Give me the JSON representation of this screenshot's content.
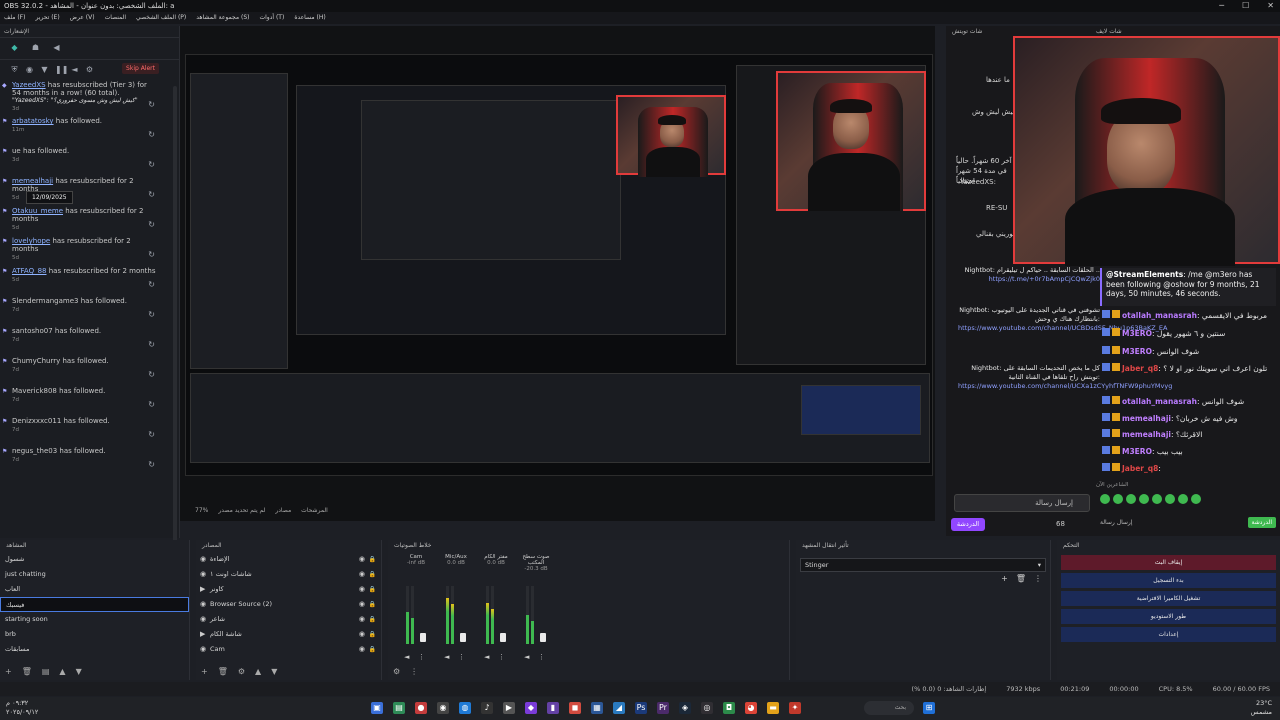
{
  "window": {
    "title": "OBS 32.0.2 - الملف الشخصي: بدون عنوان - المشاهد: a",
    "controls": [
      "─",
      "☐",
      "✕"
    ]
  },
  "menu": [
    "ملف (F)",
    "تحرير (E)",
    "عرض (V)",
    "المنصات",
    "الملف الشخصي (P)",
    "مجموعة المشاهد (S)",
    "أدوات (T)",
    "مساعدة (H)"
  ],
  "feed": {
    "header": "الإشعارات",
    "skip_label": "Skip Alert",
    "tooltip": "12/09/2025",
    "items": [
      {
        "user": "YazeedXS",
        "text": " has resubscribed (Tier 3) for 54 months in a row! (60 total).",
        "quote": "\"YazeedXS\": \"كيش ليش وش مسوى حفروري؟\"",
        "age": "3d"
      },
      {
        "user": "arbatatosky",
        "text": " has followed.",
        "quote": "",
        "age": "11m"
      },
      {
        "user": "",
        "text": "ue has followed.",
        "quote": "",
        "age": "3d"
      },
      {
        "user": "memealhaji",
        "text": " has resubscribed for 2 months",
        "quote": "",
        "age": "5d"
      },
      {
        "user": "Otakuu_meme",
        "text": " has resubscribed for 2 months",
        "quote": "",
        "age": "5d"
      },
      {
        "user": "lovelyhope",
        "text": " has resubscribed for 2 months",
        "quote": "",
        "age": "5d"
      },
      {
        "user": "ATFAQ_88",
        "text": " has resubscribed for 2 months",
        "quote": "",
        "age": "5d"
      },
      {
        "user": "",
        "text": "Slendermangame3 has followed.",
        "quote": "",
        "age": "7d"
      },
      {
        "user": "",
        "text": "santosho07 has followed.",
        "quote": "",
        "age": "7d"
      },
      {
        "user": "",
        "text": "ChumyChurry has followed.",
        "quote": "",
        "age": "7d"
      },
      {
        "user": "",
        "text": "Maverick808 has followed.",
        "quote": "",
        "age": "7d"
      },
      {
        "user": "",
        "text": "Denizxxxc011 has followed.",
        "quote": "",
        "age": "7d"
      },
      {
        "user": "",
        "text": "negus_the03 has followed.",
        "quote": "",
        "age": "7d"
      }
    ]
  },
  "preview_bottom": [
    "77%",
    "لم يتم تحديد مصدر",
    "مصادر",
    "المرشحات"
  ],
  "chat": {
    "header_left": "شات تويتش",
    "header_right": "شات لايف",
    "text_a": "ما عندها",
    "text_b": "ليش ليش وش",
    "text_c": "آخر 60 شهراً. حالياً في مدة 54 شهراً متتالياً!",
    "text_d": "YazeedXS:",
    "text_e": "RE-SU",
    "text_f": "يوريني بقنالي",
    "link1": "https://www.youtube.com/channel/UCBDsdSF_Nhu1p63BaKZ_EA",
    "link2": "https://www.youtube.com/channel/UCXa1zCYyhfTNFW9phuYMvyg",
    "nightbot1": "Nightbot: الحلقات السابقة .. حياكم ل تيليقرام ..",
    "nightbot_tg": "https://t.me/+0r7bAmpCjCQwZjk0",
    "nightbot2": "Nightbot: تشوفني في قناتي الجديدة على اليوتيوب بانتظارك هناك ي وحش:",
    "nightbot3": "Nightbot: كل ما يخص التحديمات السابقة على تويتش راح تلقاها في القناة الثانية:",
    "highlight_name": "@StreamElements",
    "highlight_text": ": /me @m3ero has been following @oshow for 9 months, 21 days, 50 minutes, 46 seconds.",
    "messages": [
      {
        "name": "otallah_manasrah",
        "text": ": مربوط في الايقسمي",
        "color": "#b97bff"
      },
      {
        "name": "M3ERO",
        "text": ": سنتين و ٦ شهور يقول",
        "color": "#c07fff"
      },
      {
        "name": "M3ERO",
        "text": ": شوف الوانس",
        "color": "#c07fff"
      },
      {
        "name": "Jaber_q8",
        "text": ": تلون اعرف اني سويتك نور او لا ؟",
        "color": "#e04747"
      },
      {
        "name": "otallah_manasrah",
        "text": ": شوف الوانس",
        "color": "#b97bff"
      },
      {
        "name": "memealhaji",
        "text": ": وش فيه ش خربان؟",
        "color": "#c07fff"
      },
      {
        "name": "memealhaji",
        "text": ": الاقرئك؟",
        "color": "#c07fff"
      },
      {
        "name": "M3ERO",
        "text": ": بيب بيب",
        "color": "#c07fff"
      },
      {
        "name": "Jaber_q8",
        "text": ": ",
        "color": "#e04747"
      }
    ],
    "input_placeholder": "إرسال رسالة",
    "chat_button": "الدردشة",
    "viewers": "68",
    "chat_button2": "الدردشة",
    "send_label": "إرسال رسالة",
    "mini_label": "الشاعرين الآن"
  },
  "docks": {
    "scenes": {
      "title": "المشاهد",
      "items": [
        "شسول",
        "just chatting",
        "العاب",
        "فيسبك",
        "starting soon",
        "brb",
        "مسابقات"
      ],
      "selected": 3
    },
    "sources": {
      "title": "المصادر",
      "items": [
        {
          "name": "الإضاءة",
          "play": false
        },
        {
          "name": "شاشات اونت ١",
          "play": false
        },
        {
          "name": "كاونر",
          "play": true
        },
        {
          "name": "Browser Source (2)",
          "play": false
        },
        {
          "name": "شاعر",
          "play": false
        },
        {
          "name": "شاشة الكام",
          "play": true
        },
        {
          "name": "Cam",
          "play": false
        }
      ]
    },
    "mixer": {
      "title": "خلاط الصوتيات",
      "channels": [
        {
          "name": "Cam",
          "db": "-inf dB",
          "level": 0.55
        },
        {
          "name": "Mic/Aux",
          "db": "0.0 dB",
          "level": 0.8
        },
        {
          "name": "مفتر الكام",
          "db": "0.0 dB",
          "level": 0.7
        },
        {
          "name": "صوت سطح المكتب",
          "db": "-20.3 dB",
          "level": 0.5
        }
      ]
    },
    "transitions": {
      "title": "تأثير انتقال المشهد",
      "selected": "Stinger"
    },
    "controls": {
      "title": "التحكم",
      "buttons": [
        {
          "label": "إيقاف البث",
          "red": true
        },
        {
          "label": "بدء التسجيل",
          "red": false
        },
        {
          "label": "تشغيل الكاميرا الافتراضية",
          "red": false
        },
        {
          "label": "طور الاستوديو",
          "red": false
        },
        {
          "label": "إعدادات",
          "red": false
        }
      ]
    }
  },
  "status": {
    "dropped": "إطارات الشاهد: 0 (0.0 %)",
    "bitrate": "7932 kbps",
    "live_time": "00:21:09",
    "rec_time": "00:00:00",
    "cpu": "CPU: 8.5%",
    "fps": "60.00 / 60.00 FPS"
  },
  "taskbar": {
    "search": "بحث",
    "time": "٠٩:٣٢ م",
    "date": "٢٠٢٥/٠٩/١٢",
    "temp": "23°C",
    "weather": "مشمس"
  }
}
